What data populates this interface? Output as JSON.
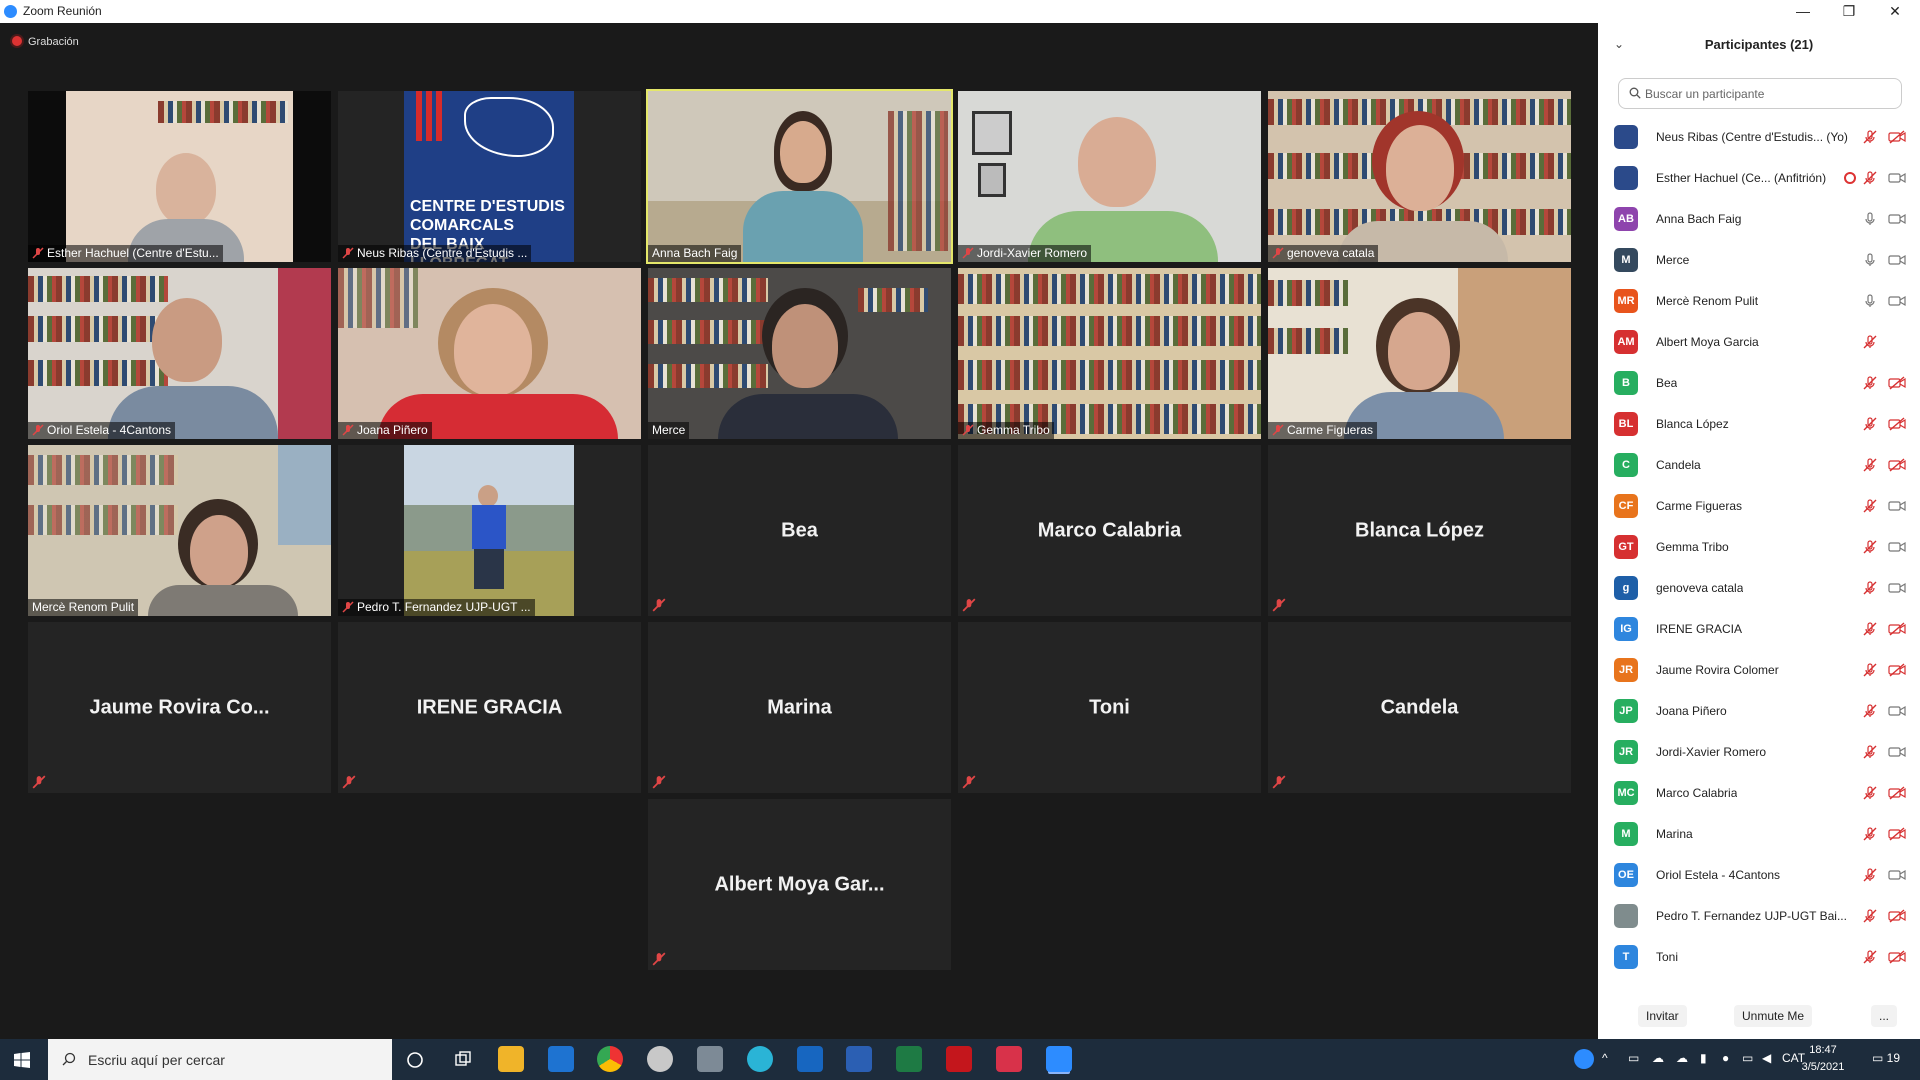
{
  "window": {
    "title": "Zoom Reunión",
    "minimize": "—",
    "maximize": "❐",
    "close": "✕"
  },
  "recording": {
    "label": "Grabación"
  },
  "tiles": [
    {
      "label": "Esther Hachuel (Centre d'Estu...",
      "muted": true,
      "video": true
    },
    {
      "label": "Neus Ribas (Centre d'Estudis ...",
      "muted": true,
      "video": true,
      "logo_lines": [
        "CENTRE D'ESTUDIS",
        "COMARCALS",
        "DEL BAIX LLOBREGAT"
      ]
    },
    {
      "label": "Anna Bach Faig",
      "muted": false,
      "video": true,
      "active": true
    },
    {
      "label": "Jordi-Xavier Romero",
      "muted": true,
      "video": true
    },
    {
      "label": "genoveva catala",
      "muted": true,
      "video": true
    },
    {
      "label": "Oriol Estela - 4Cantons",
      "muted": true,
      "video": true
    },
    {
      "label": "Joana Piñero",
      "muted": true,
      "video": true
    },
    {
      "label": "Merce",
      "muted": false,
      "video": true
    },
    {
      "label": "Gemma Tribo",
      "muted": true,
      "video": true
    },
    {
      "label": "Carme Figueras",
      "muted": true,
      "video": true
    },
    {
      "label": "Mercè Renom Pulit",
      "muted": false,
      "video": true
    },
    {
      "label": "Pedro T. Fernandez UJP-UGT ...",
      "muted": true,
      "video": true
    },
    {
      "name": "Bea",
      "muted": true,
      "video": false
    },
    {
      "name": "Marco Calabria",
      "muted": true,
      "video": false
    },
    {
      "name": "Blanca López",
      "muted": true,
      "video": false
    },
    {
      "name": "Jaume Rovira Co...",
      "muted": true,
      "video": false
    },
    {
      "name": "IRENE GRACIA",
      "muted": true,
      "video": false
    },
    {
      "name": "Marina",
      "muted": true,
      "video": false
    },
    {
      "name": "Toni",
      "muted": true,
      "video": false
    },
    {
      "name": "Candela",
      "muted": true,
      "video": false
    },
    {
      "name": "Albert Moya Gar...",
      "muted": true,
      "video": false
    }
  ],
  "panel": {
    "title": "Participantes (21)",
    "search_placeholder": "Buscar un participante",
    "participants": [
      {
        "name": "Neus Ribas (Centre d'Estudis... (Yo)",
        "avatar": "",
        "color": "#2b4a8a",
        "mic": "muted",
        "cam": "off"
      },
      {
        "name": "Esther Hachuel (Ce... (Anfitrión)",
        "avatar": "",
        "color": "#2b4a8a",
        "mic": "muted",
        "cam": "on",
        "recording": true
      },
      {
        "name": "Anna Bach Faig",
        "avatar": "AB",
        "color": "#8e44ad",
        "mic": "on",
        "cam": "on"
      },
      {
        "name": "Merce",
        "avatar": "M",
        "color": "#34495e",
        "mic": "on",
        "cam": "on"
      },
      {
        "name": "Mercè Renom Pulit",
        "avatar": "MR",
        "color": "#e8541c",
        "mic": "on",
        "cam": "on"
      },
      {
        "name": "Albert Moya Garcia",
        "avatar": "AM",
        "color": "#d63031",
        "mic": "muted",
        "cam": "none"
      },
      {
        "name": "Bea",
        "avatar": "B",
        "color": "#27ae60",
        "mic": "muted",
        "cam": "off"
      },
      {
        "name": "Blanca López",
        "avatar": "BL",
        "color": "#d63031",
        "mic": "muted",
        "cam": "off"
      },
      {
        "name": "Candela",
        "avatar": "C",
        "color": "#27ae60",
        "mic": "muted",
        "cam": "off"
      },
      {
        "name": "Carme Figueras",
        "avatar": "CF",
        "color": "#e8741c",
        "mic": "muted",
        "cam": "on"
      },
      {
        "name": "Gemma Tribo",
        "avatar": "GT",
        "color": "#d63031",
        "mic": "muted",
        "cam": "on"
      },
      {
        "name": "genoveva catala",
        "avatar": "g",
        "color": "#1e5fa8",
        "mic": "muted",
        "cam": "on"
      },
      {
        "name": "IRENE GRACIA",
        "avatar": "IG",
        "color": "#2e86de",
        "mic": "muted",
        "cam": "off"
      },
      {
        "name": "Jaume Rovira Colomer",
        "avatar": "JR",
        "color": "#e8741c",
        "mic": "muted",
        "cam": "off"
      },
      {
        "name": "Joana Piñero",
        "avatar": "JP",
        "color": "#27ae60",
        "mic": "muted",
        "cam": "on"
      },
      {
        "name": "Jordi-Xavier Romero",
        "avatar": "JR",
        "color": "#27ae60",
        "mic": "muted",
        "cam": "on"
      },
      {
        "name": "Marco Calabria",
        "avatar": "MC",
        "color": "#27ae60",
        "mic": "muted",
        "cam": "off"
      },
      {
        "name": "Marina",
        "avatar": "M",
        "color": "#27ae60",
        "mic": "muted",
        "cam": "off"
      },
      {
        "name": "Oriol Estela - 4Cantons",
        "avatar": "OE",
        "color": "#2e86de",
        "mic": "muted",
        "cam": "on"
      },
      {
        "name": "Pedro T. Fernandez UJP-UGT Bai...",
        "avatar": "",
        "color": "#7f8c8d",
        "mic": "muted",
        "cam": "off"
      },
      {
        "name": "Toni",
        "avatar": "T",
        "color": "#2e86de",
        "mic": "muted",
        "cam": "off"
      }
    ],
    "invite": "Invitar",
    "unmute": "Unmute Me",
    "more": "..."
  },
  "taskbar": {
    "search_placeholder": "Escriu aquí per cercar",
    "lang": "CAT",
    "time": "18:47",
    "date": "3/5/2021",
    "notifications": "19"
  },
  "colors": {
    "accent": "#2d8cff",
    "active_speaker": "#e4e76a",
    "muted_red": "#d63031"
  }
}
